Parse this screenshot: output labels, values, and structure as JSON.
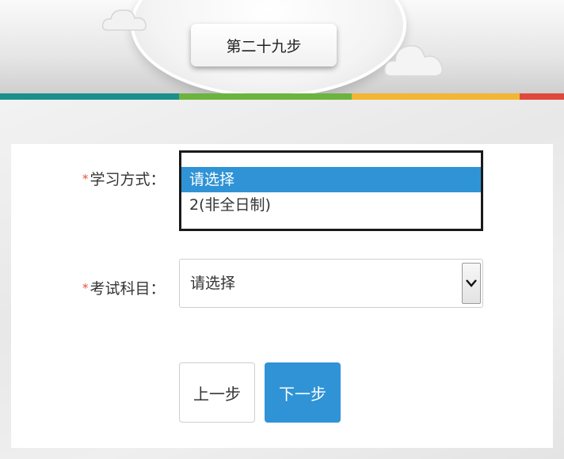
{
  "header": {
    "step_title": "第二十九步"
  },
  "form": {
    "study_mode": {
      "required_mark": "*",
      "label": "学习方式：",
      "options": [
        "请选择",
        "2(非全日制)"
      ],
      "selected": "请选择"
    },
    "exam_subject": {
      "required_mark": "*",
      "label": "考试科目：",
      "value": "请选择"
    }
  },
  "buttons": {
    "prev_label": "上一步",
    "next_label": "下一步"
  },
  "colors": {
    "primary": "#2f93d6",
    "required": "#e5533a",
    "stripe_teal": "#1b8f8d",
    "stripe_green": "#6db33f",
    "stripe_yellow": "#f2b632",
    "stripe_red": "#e0483a"
  },
  "icons": {
    "dropdown": "chevron-down-icon",
    "cloud": "cloud-icon"
  }
}
